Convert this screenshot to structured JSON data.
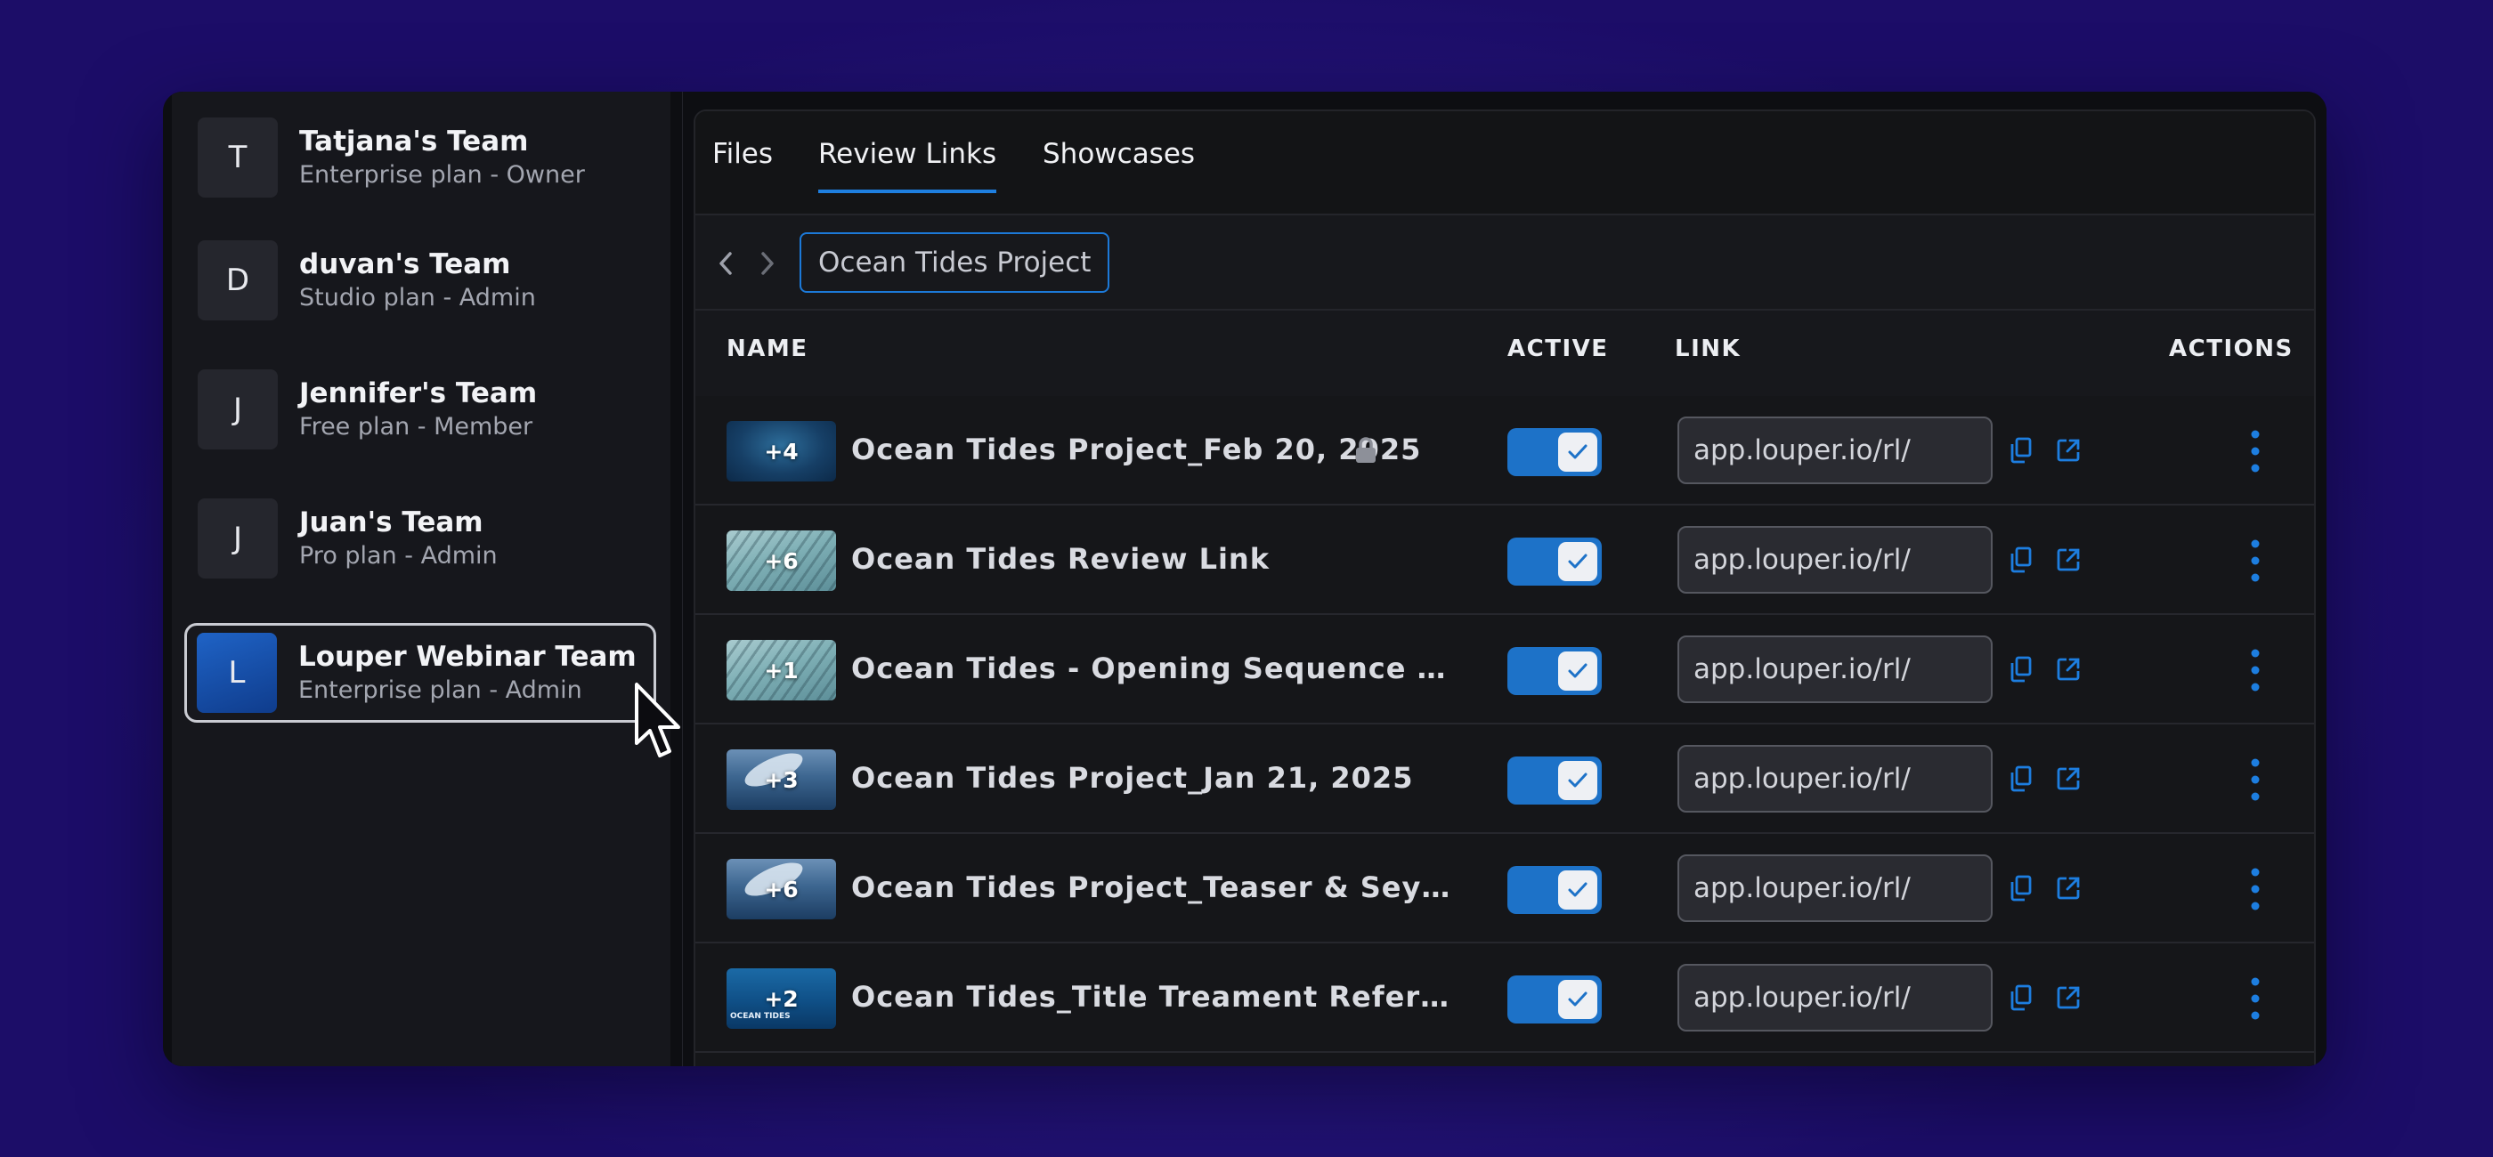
{
  "sidebar": {
    "teams": [
      {
        "initial": "T",
        "name": "Tatjana's Team",
        "plan": "Enterprise plan - Owner"
      },
      {
        "initial": "D",
        "name": "duvan's Team",
        "plan": "Studio plan - Admin"
      },
      {
        "initial": "J",
        "name": "Jennifer's Team",
        "plan": "Free plan - Member"
      },
      {
        "initial": "J",
        "name": "Juan's Team",
        "plan": "Pro plan - Admin"
      },
      {
        "initial": "L",
        "name": "Louper Webinar Team",
        "plan": "Enterprise plan - Admin",
        "selected": true
      }
    ]
  },
  "tabs": [
    {
      "label": "Files"
    },
    {
      "label": "Review Links",
      "active": true
    },
    {
      "label": "Showcases"
    }
  ],
  "breadcrumb": {
    "current": "Ocean Tides Project"
  },
  "table": {
    "columns": {
      "name": "NAME",
      "active": "ACTIVE",
      "link": "LINK",
      "actions": "ACTIONS"
    },
    "rows": [
      {
        "count": "+4",
        "name": "Ocean Tides Project_Feb 20, 2025",
        "locked": true,
        "active": true,
        "link": "app.louper.io/rl/",
        "thumb": "dark-blue"
      },
      {
        "count": "+6",
        "name": "Ocean Tides Review Link",
        "locked": false,
        "active": true,
        "link": "app.louper.io/rl/",
        "thumb": "fish"
      },
      {
        "count": "+1",
        "name": "Ocean Tides - Opening Sequence _ Ja…",
        "locked": false,
        "active": true,
        "link": "app.louper.io/rl/",
        "thumb": "fish"
      },
      {
        "count": "+3",
        "name": "Ocean Tides Project_Jan 21, 2025",
        "locked": false,
        "active": true,
        "link": "app.louper.io/rl/",
        "thumb": "whale"
      },
      {
        "count": "+6",
        "name": "Ocean Tides Project_Teaser & Seychel…",
        "locked": false,
        "active": true,
        "link": "app.louper.io/rl/",
        "thumb": "whale"
      },
      {
        "count": "+2",
        "name": "Ocean Tides_Title Treament Referenc…",
        "locked": false,
        "active": true,
        "link": "app.louper.io/rl/",
        "thumb": "ocean",
        "thumb_caption": "OCEAN TIDES"
      }
    ]
  },
  "icons": {
    "back": "chevron-left-icon",
    "forward": "chevron-right-icon",
    "lock": "lock-icon",
    "copy": "copy-icon",
    "open": "external-link-icon",
    "more": "more-vertical-icon",
    "check": "check-icon",
    "cursor": "mouse-cursor-icon"
  },
  "colors": {
    "accent": "#1d72c8",
    "background": "#26167d",
    "panel": "#151619"
  }
}
